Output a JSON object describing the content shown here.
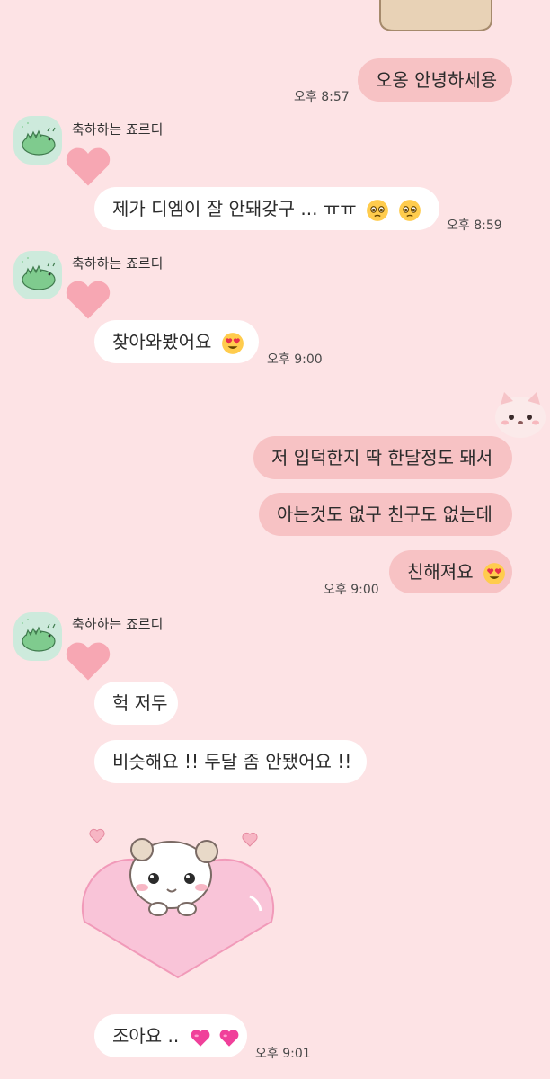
{
  "sender_name": "축하하는 죠르디",
  "messages": {
    "m1": {
      "text": "오옹 안녕하세용",
      "time": "오후 8:57"
    },
    "m2": {
      "text": "제가 디엠이 잘 안돼갖구 ... ㅠㅠ",
      "time": "오후 8:59"
    },
    "m3": {
      "text": "찾아와봤어요",
      "time": "오후 9:00"
    },
    "m4": {
      "text": "저 입덕한지 딱 한달정도 돼서"
    },
    "m5": {
      "text": "아는것도 없구 친구도 없는데"
    },
    "m6": {
      "text": "친해져요",
      "time": "오후 9:00"
    },
    "m7": {
      "text": "헉 저두"
    },
    "m8": {
      "text": "비슷해요 !! 두달 좀 안됐어요 !!"
    },
    "m9": {
      "text": "조아요 ..",
      "time": "오후 9:01"
    }
  },
  "colors": {
    "background": "#fde3e5",
    "my_bubble": "#f7c2c4",
    "their_bubble": "#ffffff",
    "avatar_bg": "#cdeadc"
  },
  "icons": {
    "sender_avatar": "green-dinosaur-avatar",
    "my_avatar": "pink-cat-avatar",
    "reaction": "heart-icon",
    "sticker": "hamster-heart-sticker"
  }
}
